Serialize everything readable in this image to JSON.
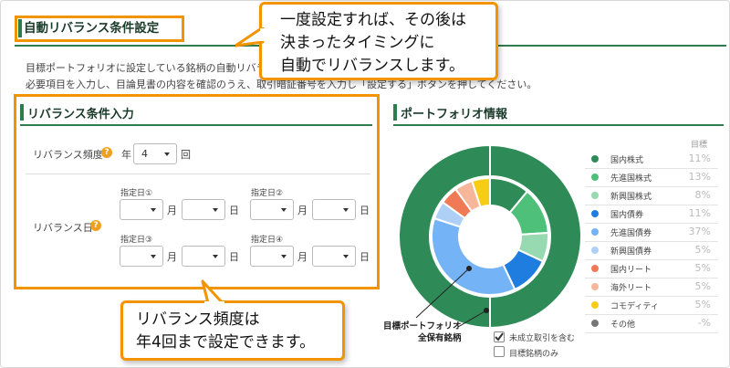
{
  "header": {
    "title": "自動リバランス条件設定",
    "intro_line1": "目標ポートフォリオに設定している銘柄の自動リバランス",
    "intro_line2": "必要項目を入力し、目論見書の内容を確認のうえ、取引暗証番号を入力し「設定する」ボタンを押してください。"
  },
  "callouts": {
    "top": [
      "一度設定すれば、その後は",
      "決まったタイミングに",
      "自動でリバランスします。"
    ],
    "bottom": [
      "リバランス頻度は",
      "年4回まで設定できます。"
    ]
  },
  "conditions": {
    "section_title": "リバランス条件入力",
    "frequency": {
      "label": "リバランス頻度",
      "prefix": "年",
      "value": "4",
      "suffix": "回"
    },
    "dates": {
      "label": "リバランス日",
      "month_unit": "月",
      "day_unit": "日",
      "slots": [
        "指定日①",
        "指定日②",
        "指定日③",
        "指定日④"
      ]
    },
    "help_glyph": "?"
  },
  "portfolio": {
    "section_title": "ポートフォリオ情報",
    "column_header": "目標",
    "inner_label": [
      "目標ポートフォリオ",
      "全保有銘柄"
    ],
    "checkboxes": [
      {
        "label": "未成立取引を含む",
        "checked": true
      },
      {
        "label": "目標銘柄のみ",
        "checked": false
      }
    ],
    "legend": [
      {
        "name": "国内株式",
        "pct": "11%",
        "color": "#2e8b57"
      },
      {
        "name": "先進国株式",
        "pct": "13%",
        "color": "#4fc07a"
      },
      {
        "name": "新興国株式",
        "pct": "8%",
        "color": "#97d9b0"
      },
      {
        "name": "国内債券",
        "pct": "11%",
        "color": "#1f7de0"
      },
      {
        "name": "先進国債券",
        "pct": "37%",
        "color": "#74b3f5"
      },
      {
        "name": "新興国債券",
        "pct": "5%",
        "color": "#aed0f7"
      },
      {
        "name": "国内リート",
        "pct": "5%",
        "color": "#f07a55"
      },
      {
        "name": "海外リート",
        "pct": "5%",
        "color": "#f6b69a"
      },
      {
        "name": "コモディティ",
        "pct": "5%",
        "color": "#f6cc14"
      },
      {
        "name": "その他",
        "pct": "-%",
        "color": "#777777"
      }
    ]
  },
  "chart_data": {
    "type": "pie",
    "title": "ポートフォリオ情報",
    "rings": [
      {
        "name": "目標ポートフォリオ",
        "labels": [
          "国内株式",
          "先進国株式",
          "新興国株式",
          "国内債券",
          "先進国債券",
          "新興国債券",
          "国内リート",
          "海外リート",
          "コモディティ"
        ],
        "values": [
          11,
          13,
          8,
          11,
          37,
          5,
          5,
          5,
          5
        ]
      },
      {
        "name": "全保有銘柄",
        "labels": [
          "国内株式"
        ],
        "values": [
          100
        ]
      }
    ],
    "colors": [
      "#2e8b57",
      "#4fc07a",
      "#97d9b0",
      "#1f7de0",
      "#74b3f5",
      "#aed0f7",
      "#f07a55",
      "#f6b69a",
      "#f6cc14"
    ]
  }
}
